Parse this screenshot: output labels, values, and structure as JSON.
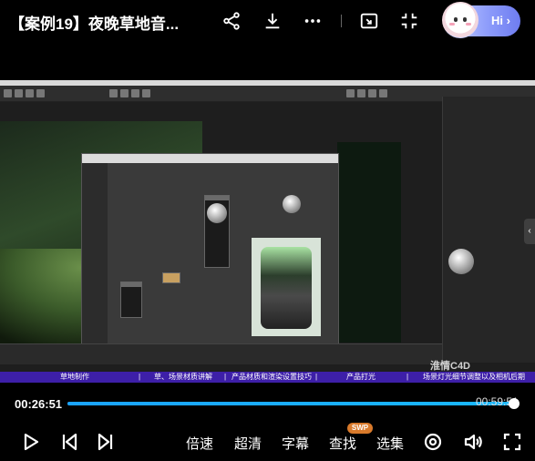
{
  "header": {
    "title": "【案例19】夜晚草地音...",
    "icons": [
      "share-icon",
      "download-icon",
      "more-icon",
      "pip-icon",
      "fullscreen-exit-icon"
    ],
    "assistant_label": "Hi",
    "assistant_arrow": "›"
  },
  "video": {
    "subtitle_band": [
      "草地制作",
      "|",
      "草、场景材质讲解",
      "|",
      "产品材质和渲染设置技巧",
      "|",
      "产品打光",
      "|",
      "场景灯光细节调整以及相机后期"
    ],
    "watermark": "淮情C4D",
    "side_arrow": "‹"
  },
  "player": {
    "current_time": "00:26:51",
    "total_time": "00:59:51",
    "progress": 0.992,
    "accent": "#1aa3ff"
  },
  "controls": {
    "speed": "倍速",
    "quality": "超清",
    "subtitles": "字幕",
    "search": "查找",
    "search_badge": "SWP",
    "episodes": "选集"
  }
}
